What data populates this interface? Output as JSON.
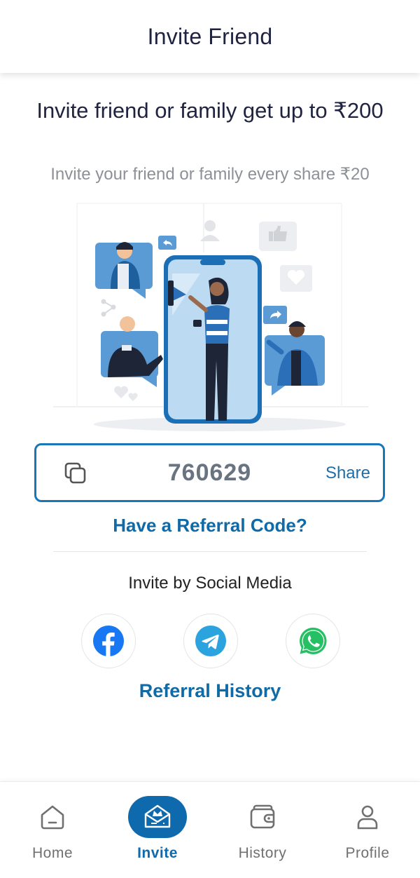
{
  "header": {
    "title": "Invite Friend"
  },
  "hero": {
    "title": "Invite friend or family get up to ₹200",
    "subtitle": "Invite your friend or family every share ₹20"
  },
  "referral": {
    "code": "760629",
    "share_label": "Share",
    "have_code_label": "Have a Referral Code?"
  },
  "social": {
    "title": "Invite by Social Media",
    "items": [
      {
        "name": "facebook",
        "icon": "facebook-icon",
        "color": "#1877f2"
      },
      {
        "name": "telegram",
        "icon": "telegram-icon",
        "color": "#2aa3df"
      },
      {
        "name": "whatsapp",
        "icon": "whatsapp-icon",
        "color": "#25c063"
      }
    ]
  },
  "referral_history_label": "Referral History",
  "bottom_nav": {
    "items": [
      {
        "label": "Home",
        "icon": "home-icon",
        "active": false
      },
      {
        "label": "Invite",
        "icon": "invite-icon",
        "active": true
      },
      {
        "label": "History",
        "icon": "wallet-icon",
        "active": false
      },
      {
        "label": "Profile",
        "icon": "profile-icon",
        "active": false
      }
    ]
  },
  "colors": {
    "accent": "#0e6aad",
    "code_border": "#1976b8",
    "title": "#1f2340",
    "muted": "#8d9197"
  }
}
